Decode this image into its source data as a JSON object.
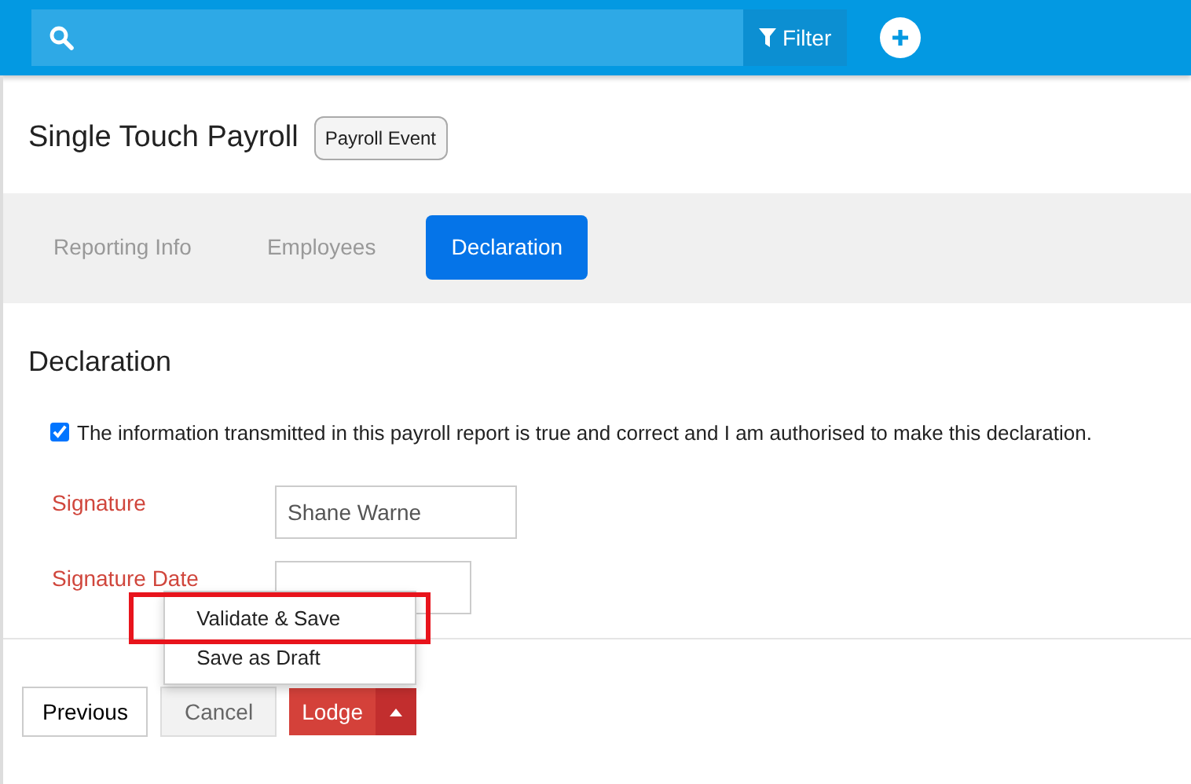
{
  "search": {
    "filter_label": "Filter"
  },
  "page": {
    "title": "Single Touch Payroll",
    "tag": "Payroll Event"
  },
  "tabs": [
    {
      "label": "Reporting Info",
      "selected": false
    },
    {
      "label": "Employees",
      "selected": false
    },
    {
      "label": "Declaration",
      "selected": true
    }
  ],
  "section": {
    "heading": "Declaration",
    "declaration": {
      "checked": true,
      "text": "The information transmitted in this payroll report is true and correct and I am authorised to make this declaration."
    },
    "fields": [
      {
        "label": "Signature",
        "value": "Shane Warne"
      },
      {
        "label": "Signature Date"
      }
    ]
  },
  "lodge_menu": [
    {
      "label": "Validate & Save",
      "highlighted": true
    },
    {
      "label": "Save as Draft",
      "highlighted": false
    }
  ],
  "buttons": {
    "previous": "Previous",
    "cancel": "Cancel",
    "lodge": "Lodge"
  }
}
